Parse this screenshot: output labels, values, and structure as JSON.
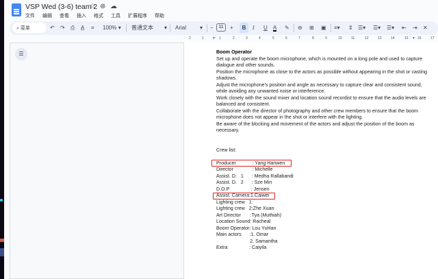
{
  "window": {
    "title": "VSP Wed (3-6) team 2"
  },
  "menu": [
    "文件",
    "编辑",
    "查看",
    "插入",
    "格式",
    "工具",
    "扩展程序",
    "帮助"
  ],
  "toolbar": {
    "search_label": "菜单",
    "zoom": "100%",
    "style": "普通文本",
    "font": "Arial",
    "font_size": "11",
    "bold": "B",
    "italic": "I",
    "underline": "U",
    "text_color": "A"
  },
  "ruler": [
    "2",
    "1",
    "1",
    "2",
    "3",
    "4",
    "5",
    "6",
    "7",
    "8",
    "9",
    "10",
    "11",
    "12",
    "13",
    "14",
    "15",
    "16",
    "17"
  ],
  "document": {
    "heading": "Boom Operator",
    "paragraphs": [
      "Set up and operate the boom microphone, which is mounted on a long pole and used to capture dialogue and other sounds.",
      "Position the microphone as close to the actors as possible without appearing in the shot or casting shadows.",
      "Adjust the microphone's position and angle as necessary to capture clear and consistent sound, while avoiding any unwanted noise or interference.",
      "Work closely with the sound mixer and location sound recordist to ensure that the audio levels are balanced and consistent.",
      "Collaborate with the director of photography and other crew members to ensure that the boom microphone does not appear in the shot or interfere with the lighting.",
      "Be aware of the blocking and movement of the actors and adjust the position of the boom as necessary."
    ],
    "crew_title": "Crew list:",
    "crew": [
      "Producer            : Yang Hanwen",
      "Director              : Michelle",
      "Assist. D.   1      : Medha Rallabandi",
      "Assist. D.   2      : Sze Min",
      "D.O.P                : Jensen",
      "Assist. Camera:1.Caiwei",
      "Lighting crew   1:",
      "Lighting crew   2:Zhe Xuan",
      "Art Director       :Tya (Muthiah)",
      "Location Sound: Racheal",
      "Boom Operator: Lou YuHan",
      "Main actors      :1. Omar",
      "                         2. Samantha",
      "Extra                : Caiyila"
    ],
    "highlight_color": "#e02020"
  }
}
